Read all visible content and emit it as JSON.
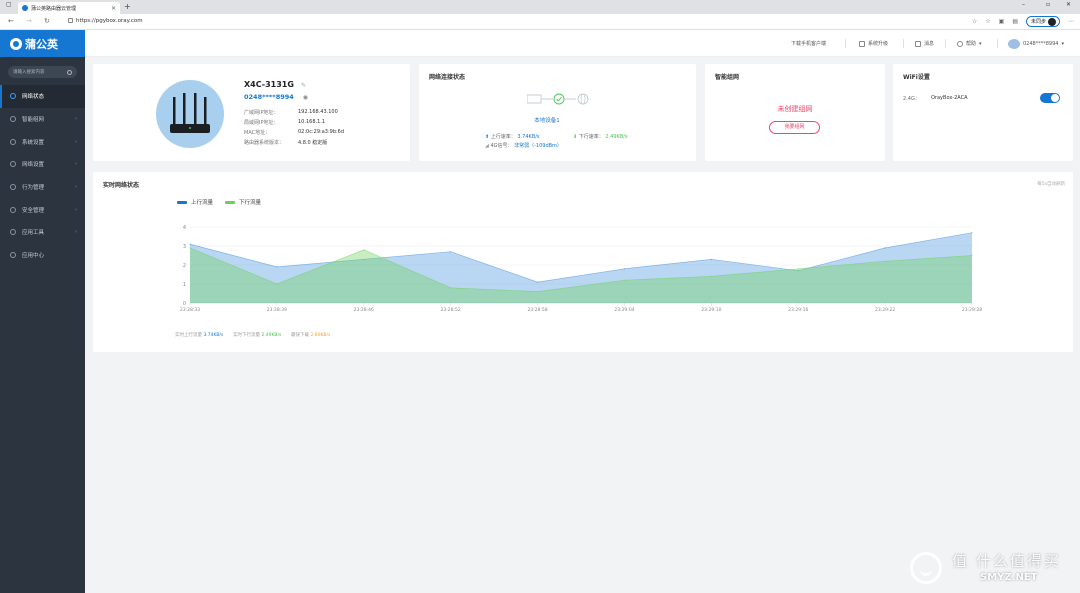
{
  "browser": {
    "tab_title": "蒲公英路由器云管理",
    "tab_close": "×",
    "new_tab": "+",
    "url": "https://pgybox.oray.com",
    "sync_label": "未同步",
    "win_min": "–",
    "win_max": "▫",
    "win_close": "✕"
  },
  "sidebar": {
    "logo": "蒲公英",
    "search_placeholder": "请输入搜索内容",
    "items": [
      {
        "label": "网络状态",
        "active": true
      },
      {
        "label": "智能组网"
      },
      {
        "label": "系统设置"
      },
      {
        "label": "网络设置"
      },
      {
        "label": "行为管理"
      },
      {
        "label": "安全管理"
      },
      {
        "label": "应用工具"
      },
      {
        "label": "应用中心"
      }
    ]
  },
  "topbar": {
    "download": "下载手机客户端",
    "upgrade": "系统升级",
    "messages": "消息",
    "help": "帮助",
    "user": "0248****8994"
  },
  "device": {
    "name": "X4C-3131G",
    "sn": "0248****8994",
    "rows": [
      {
        "k": "广域网IP地址：",
        "v": "192.168.43.100"
      },
      {
        "k": "局域网IP地址：",
        "v": "10.168.1.1"
      },
      {
        "k": "MAC地址：",
        "v": "02:0c:29:a3:9b:6d"
      },
      {
        "k": "路由器系统版本：",
        "v": "4.8.0 稳定版"
      }
    ]
  },
  "network": {
    "title": "网络连接状态",
    "local_device": "本地设备1",
    "up_label": "上行速率：",
    "up_value": "3.74KB/s",
    "down_label": "下行速率：",
    "down_value": "2.49KB/s",
    "signal_label": "4G信号：",
    "signal_value": "非常弱（-109dBm）"
  },
  "smartnet": {
    "title": "智能组网",
    "status": "未创建组网",
    "button": "我要组网"
  },
  "wifi": {
    "title": "WiFi设置",
    "band": "2.4G：",
    "ssid": "OrayBox-2ACA",
    "enabled": true
  },
  "realtime": {
    "title": "实时网络状态",
    "right_text": "每5s自动刷新",
    "legend_up": "上行流量",
    "legend_down": "下行流量",
    "foot_up_label": "实时上行流量",
    "foot_up_value": "3.74KB/s",
    "foot_down_label": "实时下行流量",
    "foot_down_value": "2.49KB/s",
    "foot_total_label": "最快下载",
    "foot_total_value": "2.80KB/s"
  },
  "chart_data": {
    "type": "area",
    "x": [
      "23:28:33",
      "23:28:39",
      "23:28:46",
      "23:28:52",
      "23:28:58",
      "23:29:04",
      "23:29:10",
      "23:29:16",
      "23:29:22",
      "23:29:28"
    ],
    "series": [
      {
        "name": "上行流量",
        "values": [
          3.1,
          1.9,
          2.3,
          2.7,
          1.1,
          1.8,
          2.3,
          1.7,
          2.9,
          3.7
        ]
      },
      {
        "name": "下行流量",
        "values": [
          2.9,
          1.0,
          2.8,
          0.8,
          0.6,
          1.2,
          1.4,
          1.8,
          2.2,
          2.5
        ]
      }
    ],
    "ylim": [
      0,
      4
    ],
    "yticks": [
      0,
      1,
      2,
      3,
      4
    ],
    "colors": {
      "up": "#1677d3",
      "down": "#6cd15a"
    },
    "grid": true,
    "legend": "top-left"
  },
  "watermark": {
    "text": "值 什么值得买",
    "sub": "SMYZ.NET"
  }
}
